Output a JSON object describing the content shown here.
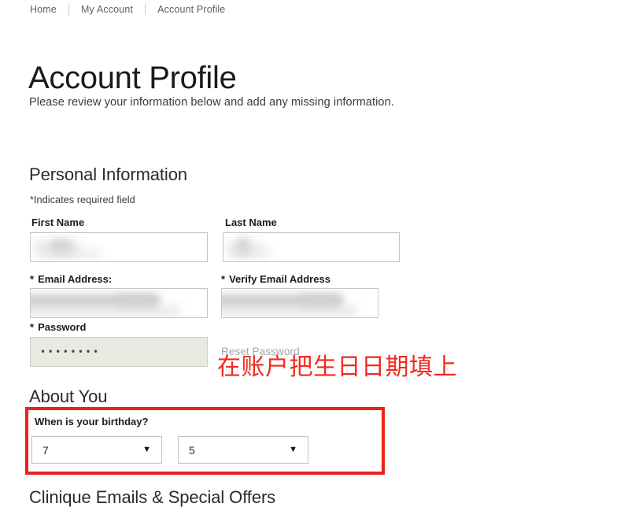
{
  "breadcrumb": {
    "items": [
      {
        "label": "Home"
      },
      {
        "label": "My Account"
      },
      {
        "label": "Account Profile"
      }
    ],
    "separator": "|"
  },
  "page": {
    "title": "Account Profile",
    "subtitle": "Please review your information below and add any missing information."
  },
  "sections": {
    "personal": {
      "heading": "Personal Information",
      "required_note": "*Indicates required field",
      "fields": {
        "first_name": {
          "label": "First Name",
          "value": "",
          "redacted": true
        },
        "last_name": {
          "label": "Last Name",
          "value": "",
          "redacted": true
        },
        "email": {
          "label": "Email Address:",
          "required_marker": "*",
          "value": "",
          "redacted": true
        },
        "verify_email": {
          "label": "Verify Email Address",
          "required_marker": "*",
          "value": "",
          "redacted": true
        },
        "password": {
          "label": "Password",
          "required_marker": "*",
          "value": "••••••••"
        }
      },
      "reset_password_link": "Reset Password"
    },
    "about_you": {
      "heading": "About You",
      "birthday_question": "When is your birthday?",
      "month_select": {
        "value": "7",
        "arrow": "▼"
      },
      "day_select": {
        "value": "5",
        "arrow": "▼"
      }
    },
    "emails_offers": {
      "heading": "Clinique Emails & Special Offers"
    }
  },
  "annotations": {
    "instruction_text": "在账户把生日日期填上",
    "highlight_color": "#ef2117",
    "text_color": "#f22a1d"
  }
}
